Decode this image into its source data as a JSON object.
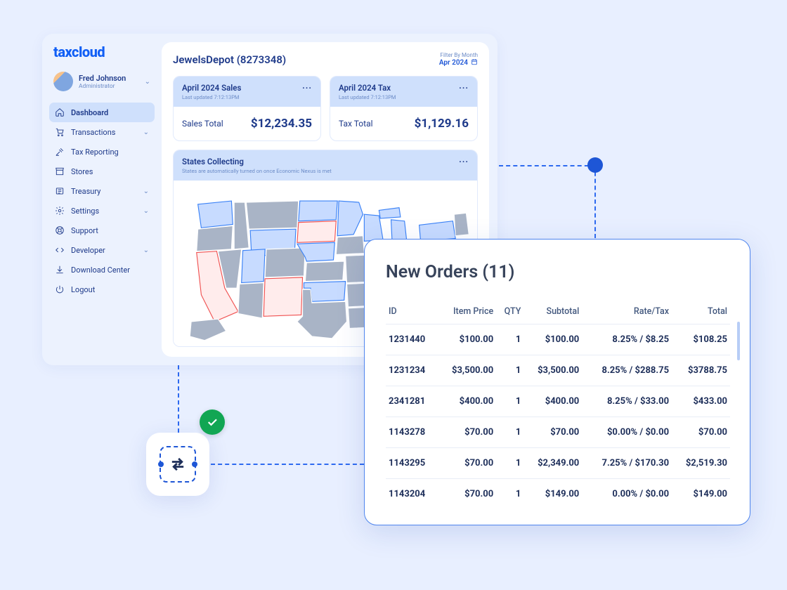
{
  "brand": "taxcloud",
  "profile": {
    "name": "Fred Johnson",
    "role": "Administrator"
  },
  "nav": {
    "dashboard": "Dashboard",
    "transactions": "Transactions",
    "tax_reporting": "Tax Reporting",
    "stores": "Stores",
    "treasury": "Treasury",
    "settings": "Settings",
    "support": "Support",
    "developer": "Developer",
    "download_center": "Download Center",
    "logout": "Logout"
  },
  "entity": "JewelsDepot (8273348)",
  "filter": {
    "label": "Filter By Month",
    "value": "Apr 2024"
  },
  "stats": {
    "sales": {
      "title": "April 2024 Sales",
      "sub": "Last updated 7:12:13PM",
      "label": "Sales Total",
      "value": "$12,234.35"
    },
    "tax": {
      "title": "April 2024 Tax",
      "sub": "Last updated 7:12:13PM",
      "label": "Tax Total",
      "value": "$1,129.16"
    }
  },
  "map": {
    "title": "States Collecting",
    "sub": "States are automatically turned on once Economic Nexus is met"
  },
  "orders": {
    "title": "New Orders (11)",
    "columns": [
      "ID",
      "Item Price",
      "QTY",
      "Subtotal",
      "Rate/Tax",
      "Total"
    ],
    "rows": [
      {
        "id": "1231440",
        "price": "$100.00",
        "qty": "1",
        "subtotal": "$100.00",
        "rate": "8.25% / $8.25",
        "total": "$108.25"
      },
      {
        "id": "1231234",
        "price": "$3,500.00",
        "qty": "1",
        "subtotal": "$3,500.00",
        "rate": "8.25% / $288.75",
        "total": "$3788.75"
      },
      {
        "id": "2341281",
        "price": "$400.00",
        "qty": "1",
        "subtotal": "$400.00",
        "rate": "8.25% / $33.00",
        "total": "$433.00"
      },
      {
        "id": "1143278",
        "price": "$70.00",
        "qty": "1",
        "subtotal": "$70.00",
        "rate": "$0.00% / $0.00",
        "total": "$70.00"
      },
      {
        "id": "1143295",
        "price": "$70.00",
        "qty": "1",
        "subtotal": "$2,349.00",
        "rate": "7.25% / $170.30",
        "total": "$2,519.30"
      },
      {
        "id": "1143204",
        "price": "$70.00",
        "qty": "1",
        "subtotal": "$149.00",
        "rate": "0.00% / $0.00",
        "total": "$149.00"
      }
    ]
  }
}
